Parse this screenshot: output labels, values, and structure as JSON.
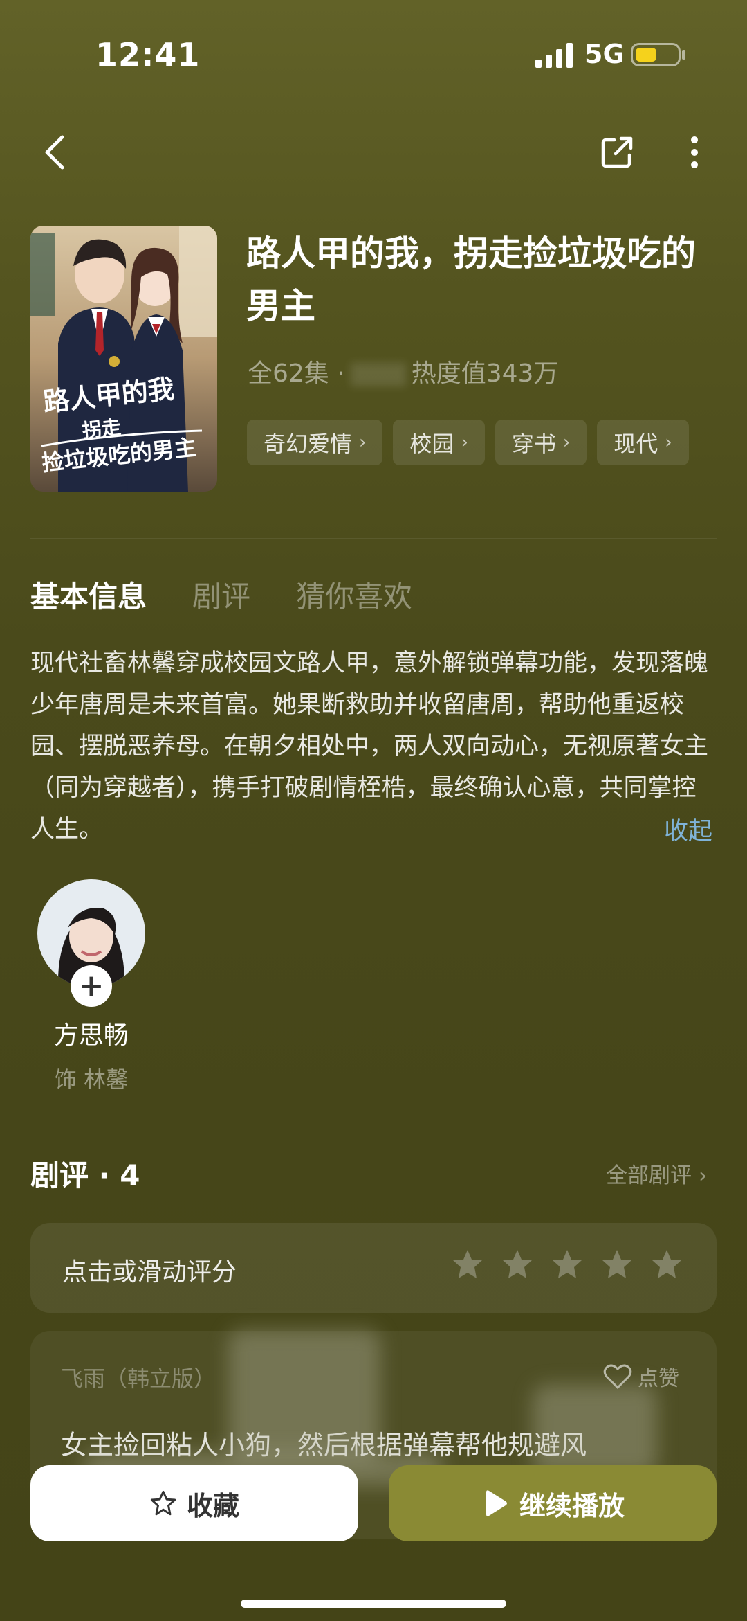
{
  "status_bar": {
    "time": "12:41",
    "network": "5G"
  },
  "drama": {
    "title": "路人甲的我，拐走捡垃圾吃的男主",
    "episodes": "全62集 ·",
    "heat": "热度值343万",
    "tags": [
      "奇幻爱情",
      "校园",
      "穿书",
      "现代"
    ],
    "poster_text": "路人甲的我，拐走捡垃圾吃的男主"
  },
  "tabs": [
    "基本信息",
    "剧评",
    "猜你喜欢"
  ],
  "synopsis": "现代社畜林馨穿成校园文路人甲，意外解锁弹幕功能，发现落魄少年唐周是未来首富。她果断救助并收留唐周，帮助他重返校园、摆脱恶养母。在朝夕相处中，两人双向动心，无视原著女主（同为穿越者），携手打破剧情桎梏，最终确认心意，共同掌控人生。",
  "collapse_label": "收起",
  "cast": [
    {
      "name": "方思畅",
      "role": "饰 林馨"
    }
  ],
  "reviews": {
    "title": "剧评 · 4",
    "all_label": "全部剧评",
    "rate_prompt": "点击或滑动评分",
    "first": {
      "user": "飞雨（韩立版）",
      "like_label": "点赞",
      "text": "女主捡回粘人小狗，然后根据弹幕帮他规避风"
    }
  },
  "actions": {
    "favorite": "收藏",
    "continue": "继续播放"
  }
}
